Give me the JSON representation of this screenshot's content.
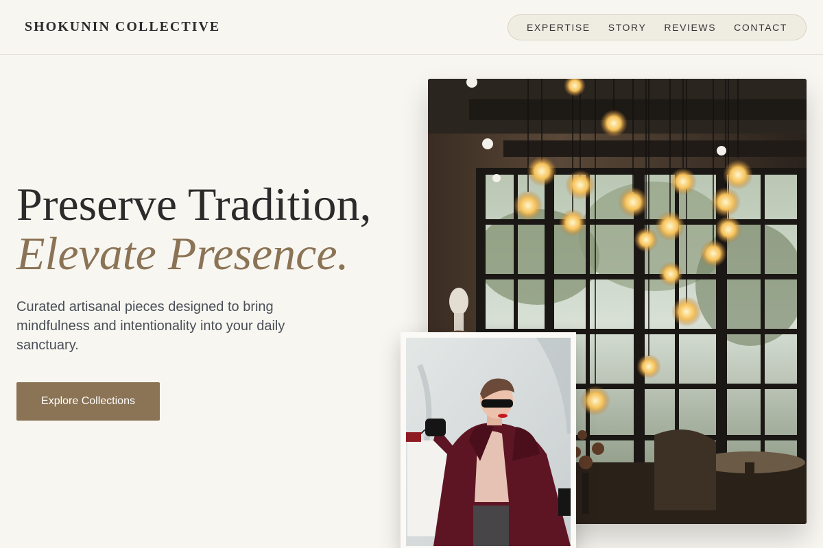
{
  "header": {
    "brand": "SHOKUNIN COLLECTIVE",
    "nav": [
      "EXPERTISE",
      "STORY",
      "REVIEWS",
      "CONTACT"
    ]
  },
  "hero": {
    "title_line1": "Preserve Tradition,",
    "title_line2": "Elevate Presence.",
    "subtitle": "Curated artisanal pieces designed to bring mindfulness and intentionality into your daily sanctuary.",
    "cta_label": "Explore Collections"
  },
  "images": {
    "main": "cafe-interior-with-hanging-cage-pendant-lights",
    "secondary": "woman-in-sunglasses-holding-shopping-bags"
  },
  "colors": {
    "background": "#f8f6f1",
    "accent": "#8b7355",
    "text": "#2b2b2b",
    "nav_pill": "#efece2"
  }
}
